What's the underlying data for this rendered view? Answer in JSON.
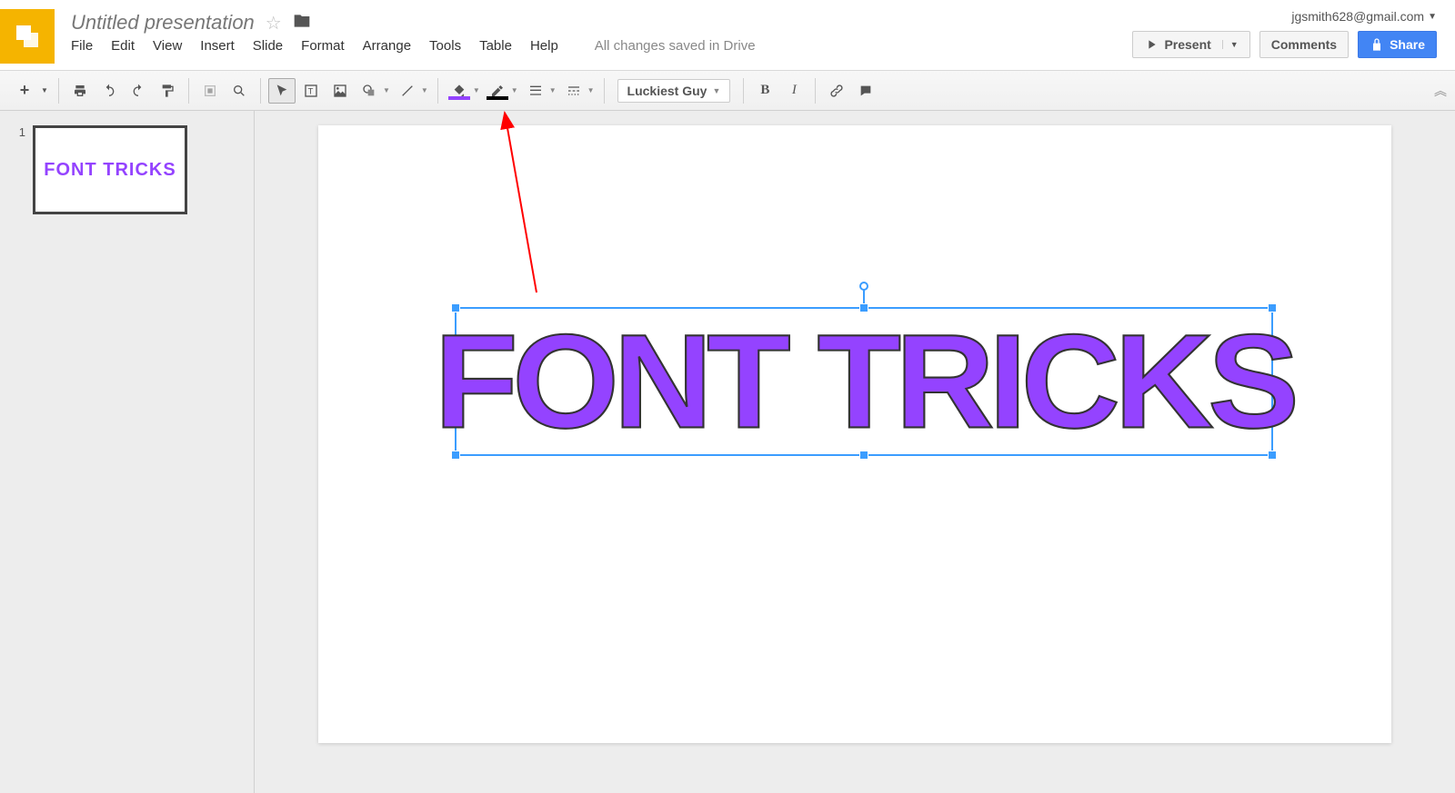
{
  "header": {
    "doc_title": "Untitled presentation",
    "user_email": "jgsmith628@gmail.com",
    "present_label": "Present",
    "comments_label": "Comments",
    "share_label": "Share"
  },
  "menus": {
    "file": "File",
    "edit": "Edit",
    "view": "View",
    "insert": "Insert",
    "slide": "Slide",
    "format": "Format",
    "arrange": "Arrange",
    "tools": "Tools",
    "table": "Table",
    "help": "Help",
    "status": "All changes saved in Drive"
  },
  "toolbar": {
    "font_name": "Luckiest Guy"
  },
  "sidebar": {
    "slides": [
      {
        "number": "1",
        "thumb_text": "FONT TRICKS"
      }
    ]
  },
  "canvas": {
    "main_text": "FONT TRICKS"
  },
  "colors": {
    "accent_fill": "#9443ff",
    "brand_orange": "#f5b400",
    "share_blue": "#4285f4"
  }
}
